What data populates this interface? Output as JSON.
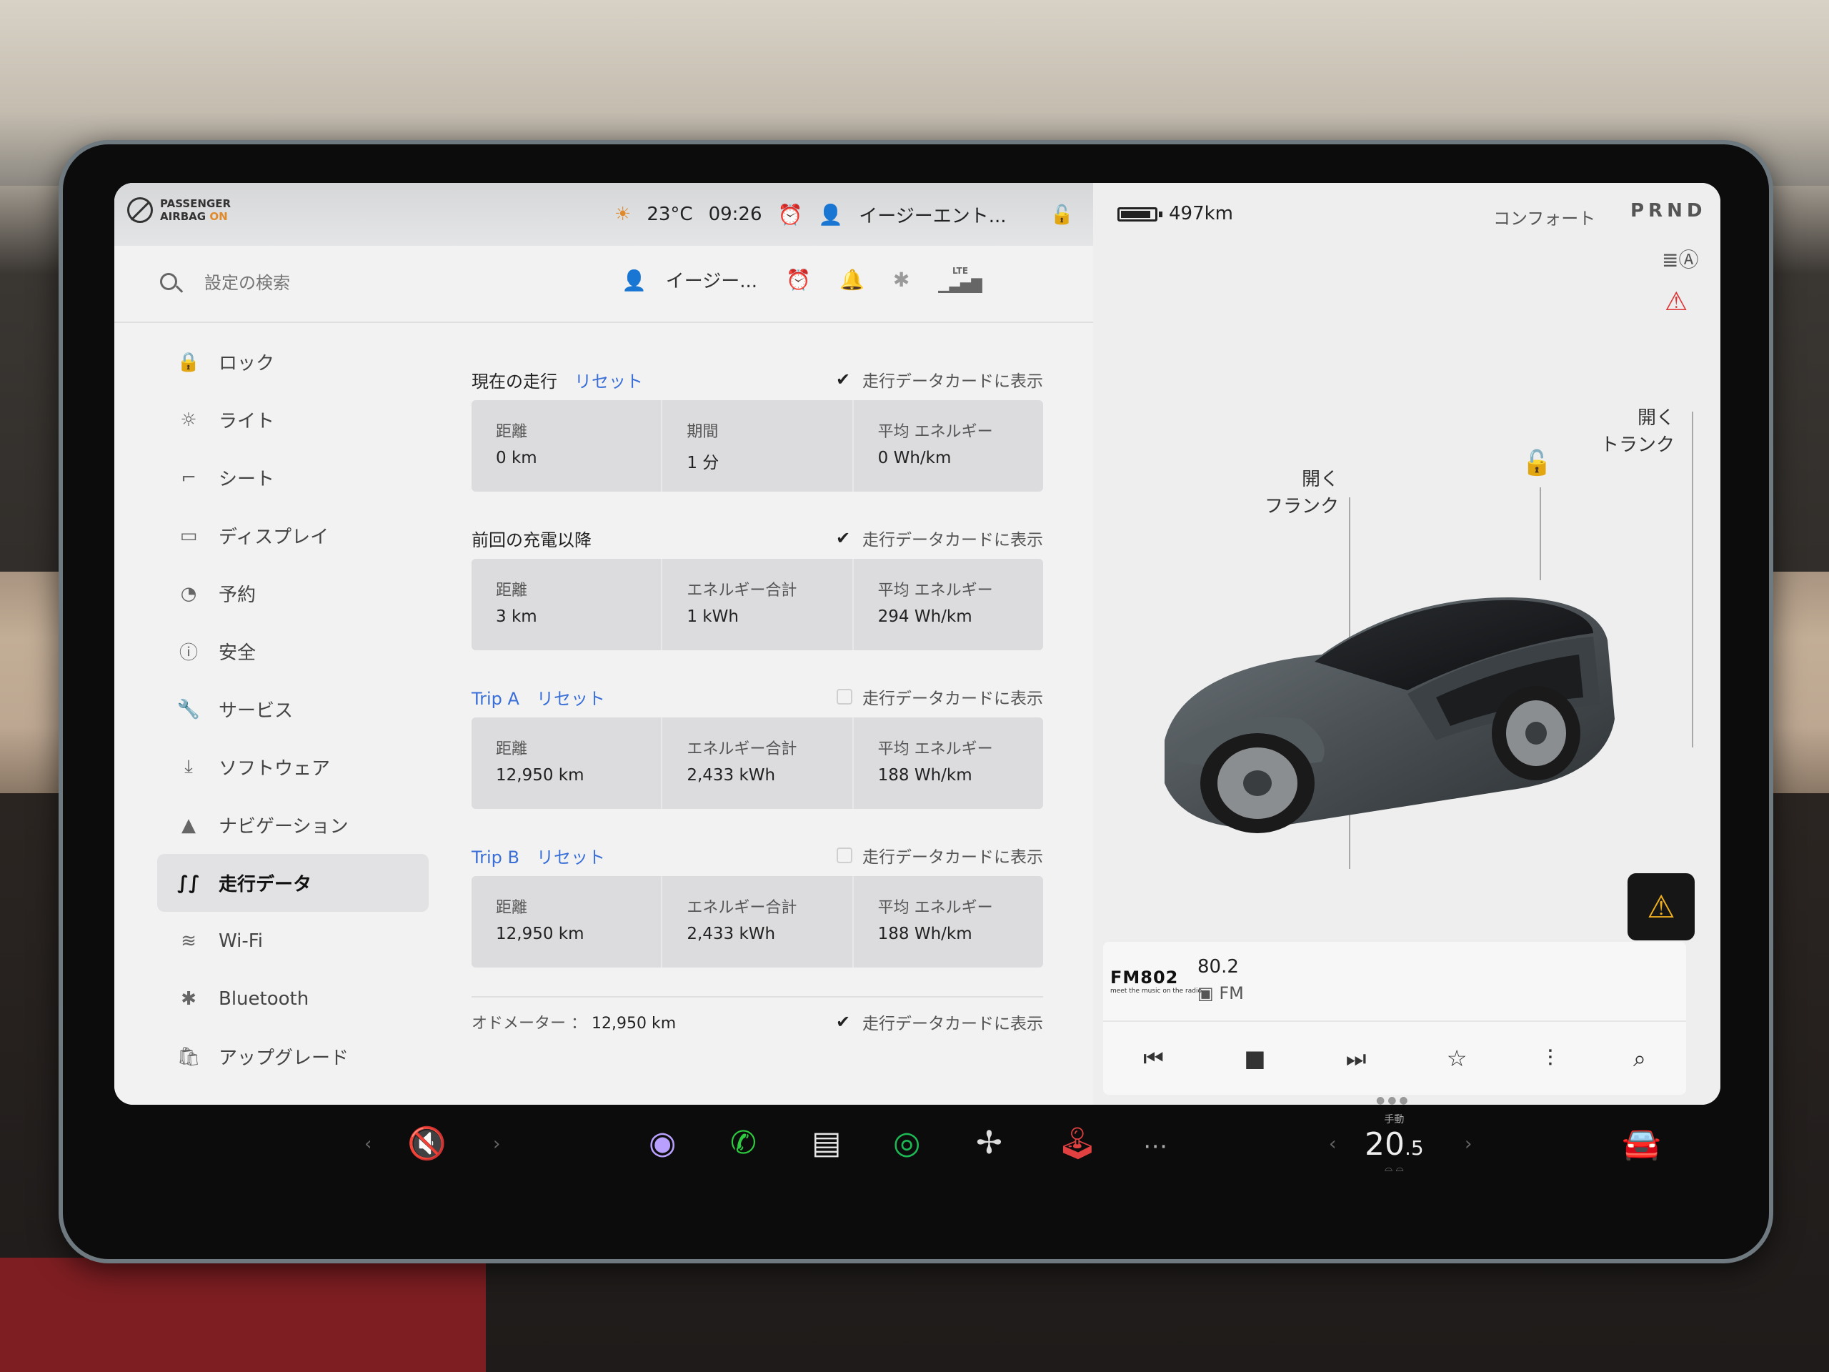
{
  "status_left": {
    "airbag_line1": "PASSENGER",
    "airbag_line2": "AIRBAG",
    "airbag_state": "ON",
    "temperature": "23°C",
    "time": "09:26",
    "profile": "イージーエント..."
  },
  "search": {
    "placeholder": "設定の検索"
  },
  "top_bar": {
    "profile_short": "イージー...",
    "lte": "LTE"
  },
  "nav": {
    "items": [
      {
        "label": "ロック",
        "icon": "🔒"
      },
      {
        "label": "ライト",
        "icon": "☼"
      },
      {
        "label": "シート",
        "icon": "⌐"
      },
      {
        "label": "ディスプレイ",
        "icon": "▭"
      },
      {
        "label": "予約",
        "icon": "◔"
      },
      {
        "label": "安全",
        "icon": "ⓘ"
      },
      {
        "label": "サービス",
        "icon": "🔧"
      },
      {
        "label": "ソフトウェア",
        "icon": "⤓"
      },
      {
        "label": "ナビゲーション",
        "icon": "▲"
      },
      {
        "label": "走行データ",
        "icon": "∫∫"
      },
      {
        "label": "Wi-Fi",
        "icon": "≋"
      },
      {
        "label": "Bluetooth",
        "icon": "✱"
      },
      {
        "label": "アップグレード",
        "icon": "🛍"
      }
    ],
    "active_index": 9
  },
  "trips": {
    "show_card_label": "走行データカードに表示",
    "reset_label": "リセット",
    "current": {
      "title": "現在の走行",
      "show_checked": true,
      "cells": [
        {
          "label": "距離",
          "value": "0 km"
        },
        {
          "label": "期間",
          "value": "1 分"
        },
        {
          "label": "平均 エネルギー",
          "value": "0 Wh/km"
        }
      ]
    },
    "since_charge": {
      "title": "前回の充電以降",
      "show_checked": true,
      "cells": [
        {
          "label": "距離",
          "value": "3 km"
        },
        {
          "label": "エネルギー合計",
          "value": "1 kWh"
        },
        {
          "label": "平均 エネルギー",
          "value": "294 Wh/km"
        }
      ]
    },
    "trip_a": {
      "title": "Trip A",
      "show_checked": false,
      "cells": [
        {
          "label": "距離",
          "value": "12,950 km"
        },
        {
          "label": "エネルギー合計",
          "value": "2,433 kWh"
        },
        {
          "label": "平均 エネルギー",
          "value": "188 Wh/km"
        }
      ]
    },
    "trip_b": {
      "title": "Trip B",
      "show_checked": false,
      "cells": [
        {
          "label": "距離",
          "value": "12,950 km"
        },
        {
          "label": "エネルギー合計",
          "value": "2,433 kWh"
        },
        {
          "label": "平均 エネルギー",
          "value": "188 Wh/km"
        }
      ]
    },
    "odometer_label": "オドメーター ：",
    "odometer_value": "12,950 km",
    "odometer_show_checked": true
  },
  "car_panel": {
    "range": "497km",
    "battery_level_pct": 90,
    "drive_mode": "コンフォート",
    "gear": "PRND",
    "frunk_line1": "開く",
    "frunk_line2": "フランク",
    "trunk_line1": "開く",
    "trunk_line2": "トランク"
  },
  "media": {
    "station_logo": "FM802",
    "station_tagline": "meet the music on the radio",
    "frequency": "80.2",
    "band": "FM"
  },
  "dock": {
    "temp_mode": "手動",
    "temp_int": "20",
    "temp_dec": ".5"
  },
  "colors": {
    "accent_blue": "#3a6fd8",
    "alarm_orange": "#e08a2b",
    "spotify_green": "#1db954",
    "phone_green": "#2ecc40",
    "alert_yellow": "#f0b020",
    "seatbelt_red": "#dd3333"
  }
}
